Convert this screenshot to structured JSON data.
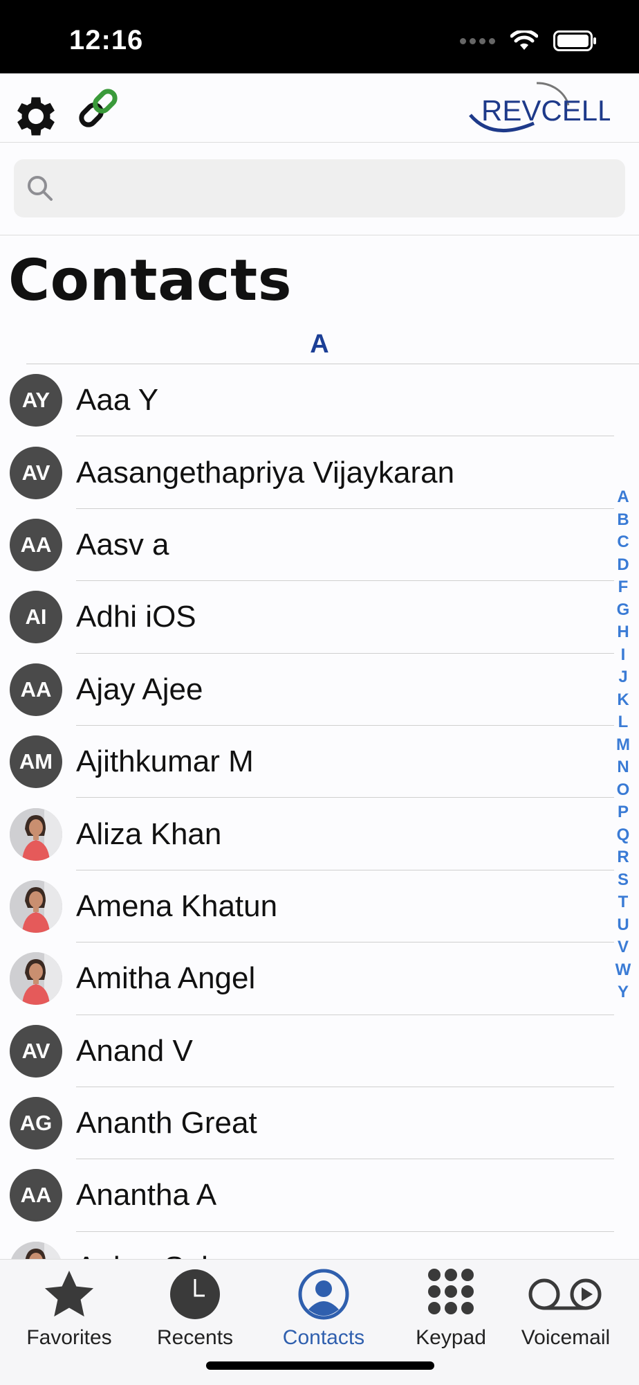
{
  "status_bar": {
    "time": "12:16"
  },
  "header": {
    "logo_text": "REVCELL"
  },
  "search": {
    "placeholder": ""
  },
  "page_title": "Contacts",
  "section": "A",
  "contacts": [
    {
      "initials": "AY",
      "name": "Aaa Y",
      "photo": false
    },
    {
      "initials": "AV",
      "name": "Aasangethapriya Vijaykaran",
      "photo": false
    },
    {
      "initials": "AA",
      "name": "Aasv a",
      "photo": false
    },
    {
      "initials": "AI",
      "name": "Adhi iOS",
      "photo": false
    },
    {
      "initials": "AA",
      "name": "Ajay Ajee",
      "photo": false
    },
    {
      "initials": "AM",
      "name": "Ajithkumar M",
      "photo": false
    },
    {
      "initials": "",
      "name": "Aliza Khan",
      "photo": true
    },
    {
      "initials": "",
      "name": "Amena Khatun",
      "photo": true
    },
    {
      "initials": "",
      "name": "Amitha Angel",
      "photo": true
    },
    {
      "initials": "AV",
      "name": "Anand V",
      "photo": false
    },
    {
      "initials": "AG",
      "name": "Ananth Great",
      "photo": false
    },
    {
      "initials": "AA",
      "name": "Anantha A",
      "photo": false
    },
    {
      "initials": "",
      "name": "Ankur Sah",
      "photo": true
    }
  ],
  "index_letters": [
    "A",
    "B",
    "C",
    "D",
    "F",
    "G",
    "H",
    "I",
    "J",
    "K",
    "L",
    "M",
    "N",
    "O",
    "P",
    "Q",
    "R",
    "S",
    "T",
    "U",
    "V",
    "W",
    "Y"
  ],
  "tabs": [
    {
      "label": "Favorites",
      "icon": "star-icon",
      "active": false
    },
    {
      "label": "Recents",
      "icon": "clock-icon",
      "active": false
    },
    {
      "label": "Contacts",
      "icon": "person-circle-icon",
      "active": true
    },
    {
      "label": "Keypad",
      "icon": "keypad-icon",
      "active": false
    },
    {
      "label": "Voicemail",
      "icon": "voicemail-icon",
      "active": false
    }
  ],
  "colors": {
    "accent": "#2f5fae",
    "index": "#3a7bd5",
    "avatar_bg": "#4a4a4a",
    "link_green": "#3a9a3a"
  }
}
